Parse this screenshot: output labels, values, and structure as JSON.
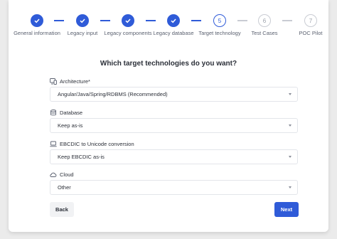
{
  "stepper": {
    "steps": [
      {
        "label": "General information",
        "state": "done"
      },
      {
        "label": "Legacy input",
        "state": "done"
      },
      {
        "label": "Legacy components",
        "state": "done"
      },
      {
        "label": "Legacy database",
        "state": "done"
      },
      {
        "label": "Target technology",
        "state": "active",
        "number": "5"
      },
      {
        "label": "Test Cases",
        "state": "pending",
        "number": "6"
      },
      {
        "label": "POC Pilot",
        "state": "pending",
        "number": "7"
      }
    ]
  },
  "form": {
    "title": "Which target technologies do you want?",
    "fields": [
      {
        "label": "Architecture*",
        "icon": "monitor-icon",
        "value": "Angular/Java/Spring/RDBMS (Recommended)"
      },
      {
        "label": "Database",
        "icon": "database-icon",
        "value": "Keep as-is"
      },
      {
        "label": "EBCDIC to Unicode conversion",
        "icon": "laptop-icon",
        "value": "Keep EBCDIC as-is"
      },
      {
        "label": "Cloud",
        "icon": "cloud-icon",
        "value": "Other"
      }
    ]
  },
  "actions": {
    "back_label": "Back",
    "next_label": "Next"
  },
  "colors": {
    "accent": "#2f5bd8",
    "pending": "#c9ccd3"
  }
}
